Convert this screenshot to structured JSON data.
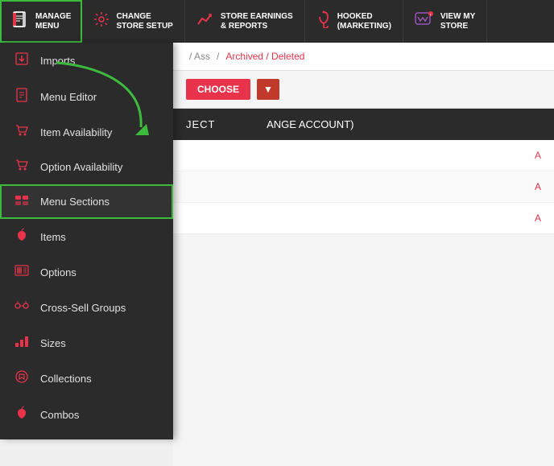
{
  "nav": {
    "items": [
      {
        "id": "manage-menu",
        "label_line1": "MANAGE",
        "label_line2": "MENU",
        "icon": "book",
        "active": true
      },
      {
        "id": "change-store-setup",
        "label_line1": "CHANGE",
        "label_line2": "STORE SETUP",
        "icon": "gear"
      },
      {
        "id": "store-earnings",
        "label_line1": "STORE EARNINGS",
        "label_line2": "& REPORTS",
        "icon": "chart"
      },
      {
        "id": "hooked",
        "label_line1": "HOOKED",
        "label_line2": "(MARKETING)",
        "icon": "hook"
      },
      {
        "id": "view-my-store",
        "label_line1": "VIEW MY",
        "label_line2": "STORE",
        "icon": "woo"
      }
    ]
  },
  "dropdown": {
    "items": [
      {
        "id": "imports",
        "label": "Imports",
        "icon": "import"
      },
      {
        "id": "menu-editor",
        "label": "Menu Editor",
        "icon": "editor"
      },
      {
        "id": "item-availability",
        "label": "Item Availability",
        "icon": "availability"
      },
      {
        "id": "option-availability",
        "label": "Option Availability",
        "icon": "option"
      },
      {
        "id": "menu-sections",
        "label": "Menu Sections",
        "icon": "sections",
        "highlighted": true
      },
      {
        "id": "items",
        "label": "Items",
        "icon": "items"
      },
      {
        "id": "options",
        "label": "Options",
        "icon": "options"
      },
      {
        "id": "cross-sell-groups",
        "label": "Cross-Sell Groups",
        "icon": "crosssell"
      },
      {
        "id": "sizes",
        "label": "Sizes",
        "icon": "sizes"
      },
      {
        "id": "collections",
        "label": "Collections",
        "icon": "collections"
      },
      {
        "id": "combos",
        "label": "Combos",
        "icon": "combos"
      }
    ]
  },
  "content": {
    "breadcrumb_partial": "/ Ass",
    "archived_deleted_label": "Archived / Deleted",
    "choose_label": "CHOOSE",
    "dark_section_text": "JECT                    ANGE ACCOUNT)",
    "table_rows": [
      {
        "action": "A"
      },
      {
        "action": "A"
      },
      {
        "action": "A"
      }
    ]
  }
}
